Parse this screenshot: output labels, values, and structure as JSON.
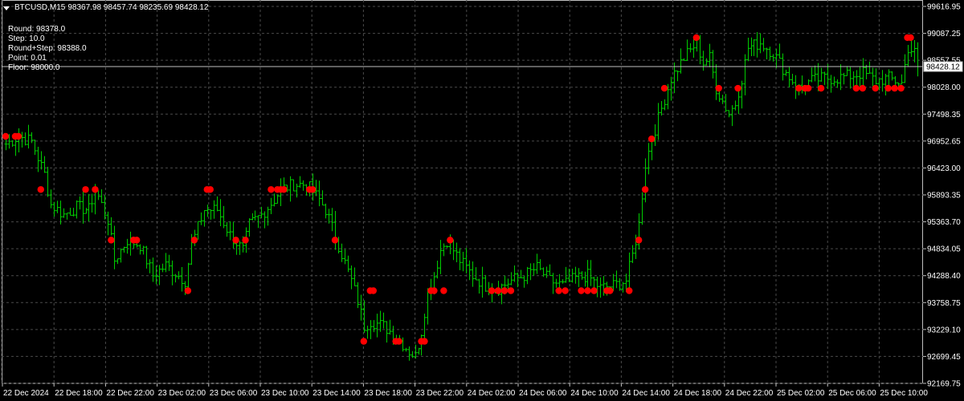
{
  "header": {
    "symbol": "BTCUSD,M15",
    "ohlc": "98367.98 98457.74 98235.69 98428.12"
  },
  "info_panel": {
    "round": "Round: 98378.0",
    "step": "Step: 10.0",
    "round_step": "Round+Step: 98388.0",
    "point": "Point: 0.01",
    "floor": "Floor: 98000.0"
  },
  "price_axis": {
    "labels": [
      "99616.95",
      "99087.25",
      "98557.55",
      "98028.00",
      "97498.35",
      "96952.65",
      "96423.00",
      "95893.35",
      "95363.70",
      "94834.05",
      "94288.40",
      "93758.75",
      "93229.10",
      "92699.45",
      "92169.75"
    ],
    "current_price": "98428.12"
  },
  "time_axis": {
    "labels": [
      "22 Dec 2024",
      "22 Dec 18:00",
      "22 Dec 22:00",
      "23 Dec 02:00",
      "23 Dec 06:00",
      "23 Dec 10:00",
      "23 Dec 14:00",
      "23 Dec 18:00",
      "23 Dec 22:00",
      "24 Dec 02:00",
      "24 Dec 06:00",
      "24 Dec 10:00",
      "24 Dec 14:00",
      "24 Dec 18:00",
      "24 Dec 22:00",
      "25 Dec 02:00",
      "25 Dec 06:00",
      "25 Dec 10:00"
    ]
  },
  "colors": {
    "background": "#000000",
    "grid": "#4a4a4a",
    "bars": "#00cc00",
    "markers": "#ff0000",
    "axis_text": "#ffffff",
    "price_line": "#c0c0c0"
  },
  "chart_data": {
    "type": "bar",
    "ylim": [
      92169.75,
      99616.95
    ],
    "x_start": "22 Dec 2024 14:00",
    "interval": "M15",
    "grid": true,
    "anchors_close": [
      [
        0,
        96900
      ],
      [
        4,
        97050
      ],
      [
        8,
        96950
      ],
      [
        12,
        96300
      ],
      [
        14,
        95700
      ],
      [
        18,
        95500
      ],
      [
        22,
        95650
      ],
      [
        26,
        95600
      ],
      [
        28,
        96000
      ],
      [
        32,
        95400
      ],
      [
        34,
        94600
      ],
      [
        38,
        95000
      ],
      [
        42,
        94900
      ],
      [
        46,
        94300
      ],
      [
        50,
        94500
      ],
      [
        56,
        94200
      ],
      [
        58,
        94900
      ],
      [
        62,
        95600
      ],
      [
        66,
        95600
      ],
      [
        70,
        95100
      ],
      [
        74,
        94800
      ],
      [
        76,
        95300
      ],
      [
        80,
        95500
      ],
      [
        84,
        95800
      ],
      [
        86,
        96000
      ],
      [
        90,
        96100
      ],
      [
        94,
        96100
      ],
      [
        98,
        95800
      ],
      [
        100,
        95600
      ],
      [
        104,
        94900
      ],
      [
        108,
        94200
      ],
      [
        110,
        93800
      ],
      [
        112,
        93300
      ],
      [
        114,
        93400
      ],
      [
        118,
        93300
      ],
      [
        122,
        93100
      ],
      [
        126,
        92800
      ],
      [
        128,
        92700
      ],
      [
        130,
        93200
      ],
      [
        132,
        94000
      ],
      [
        134,
        94300
      ],
      [
        136,
        94800
      ],
      [
        138,
        95000
      ],
      [
        142,
        94600
      ],
      [
        146,
        94300
      ],
      [
        150,
        94100
      ],
      [
        154,
        94050
      ],
      [
        158,
        94200
      ],
      [
        162,
        94300
      ],
      [
        166,
        94450
      ],
      [
        170,
        94200
      ],
      [
        174,
        94100
      ],
      [
        178,
        94250
      ],
      [
        182,
        94300
      ],
      [
        186,
        94050
      ],
      [
        190,
        94100
      ],
      [
        194,
        94200
      ],
      [
        196,
        94700
      ],
      [
        198,
        95300
      ],
      [
        200,
        96500
      ],
      [
        202,
        97000
      ],
      [
        204,
        97400
      ],
      [
        206,
        97800
      ],
      [
        208,
        98200
      ],
      [
        212,
        98600
      ],
      [
        216,
        98900
      ],
      [
        218,
        98500
      ],
      [
        220,
        98600
      ],
      [
        222,
        98000
      ],
      [
        226,
        97500
      ],
      [
        228,
        97700
      ],
      [
        230,
        98200
      ],
      [
        232,
        98800
      ],
      [
        236,
        98900
      ],
      [
        240,
        98700
      ],
      [
        244,
        98300
      ],
      [
        248,
        98000
      ],
      [
        252,
        98150
      ],
      [
        256,
        98200
      ],
      [
        260,
        98200
      ],
      [
        264,
        98250
      ],
      [
        268,
        98300
      ],
      [
        272,
        98150
      ],
      [
        276,
        98200
      ],
      [
        280,
        98100
      ],
      [
        282,
        98800
      ],
      [
        284,
        98700
      ],
      [
        285,
        98428
      ]
    ],
    "markers": [
      [
        0,
        97050
      ],
      [
        3,
        97050
      ],
      [
        4,
        97050
      ],
      [
        11,
        96000
      ],
      [
        25,
        96000
      ],
      [
        28,
        96000
      ],
      [
        33,
        95000
      ],
      [
        40,
        95000
      ],
      [
        41,
        95000
      ],
      [
        57,
        94000
      ],
      [
        59,
        95000
      ],
      [
        63,
        96000
      ],
      [
        64,
        96000
      ],
      [
        72,
        95000
      ],
      [
        75,
        95000
      ],
      [
        83,
        96000
      ],
      [
        85,
        96000
      ],
      [
        86,
        96000
      ],
      [
        87,
        96000
      ],
      [
        95,
        96000
      ],
      [
        96,
        96000
      ],
      [
        103,
        95000
      ],
      [
        112,
        93000
      ],
      [
        114,
        94000
      ],
      [
        115,
        94000
      ],
      [
        122,
        93000
      ],
      [
        123,
        93000
      ],
      [
        130,
        93000
      ],
      [
        131,
        93000
      ],
      [
        133,
        94000
      ],
      [
        134,
        94000
      ],
      [
        137,
        94000
      ],
      [
        139,
        95000
      ],
      [
        152,
        94000
      ],
      [
        154,
        94000
      ],
      [
        156,
        94000
      ],
      [
        158,
        94000
      ],
      [
        173,
        94000
      ],
      [
        175,
        94000
      ],
      [
        180,
        94000
      ],
      [
        182,
        94000
      ],
      [
        184,
        94000
      ],
      [
        188,
        94000
      ],
      [
        189,
        94000
      ],
      [
        195,
        94000
      ],
      [
        198,
        95000
      ],
      [
        200,
        96000
      ],
      [
        202,
        97000
      ],
      [
        206,
        98000
      ],
      [
        216,
        99000
      ],
      [
        223,
        98000
      ],
      [
        229,
        98000
      ],
      [
        248,
        98000
      ],
      [
        250,
        98000
      ],
      [
        251,
        98000
      ],
      [
        255,
        98000
      ],
      [
        266,
        98000
      ],
      [
        268,
        98000
      ],
      [
        272,
        98000
      ],
      [
        276,
        98000
      ],
      [
        278,
        98000
      ],
      [
        280,
        98000
      ],
      [
        282,
        99000
      ],
      [
        283,
        99000
      ]
    ]
  }
}
